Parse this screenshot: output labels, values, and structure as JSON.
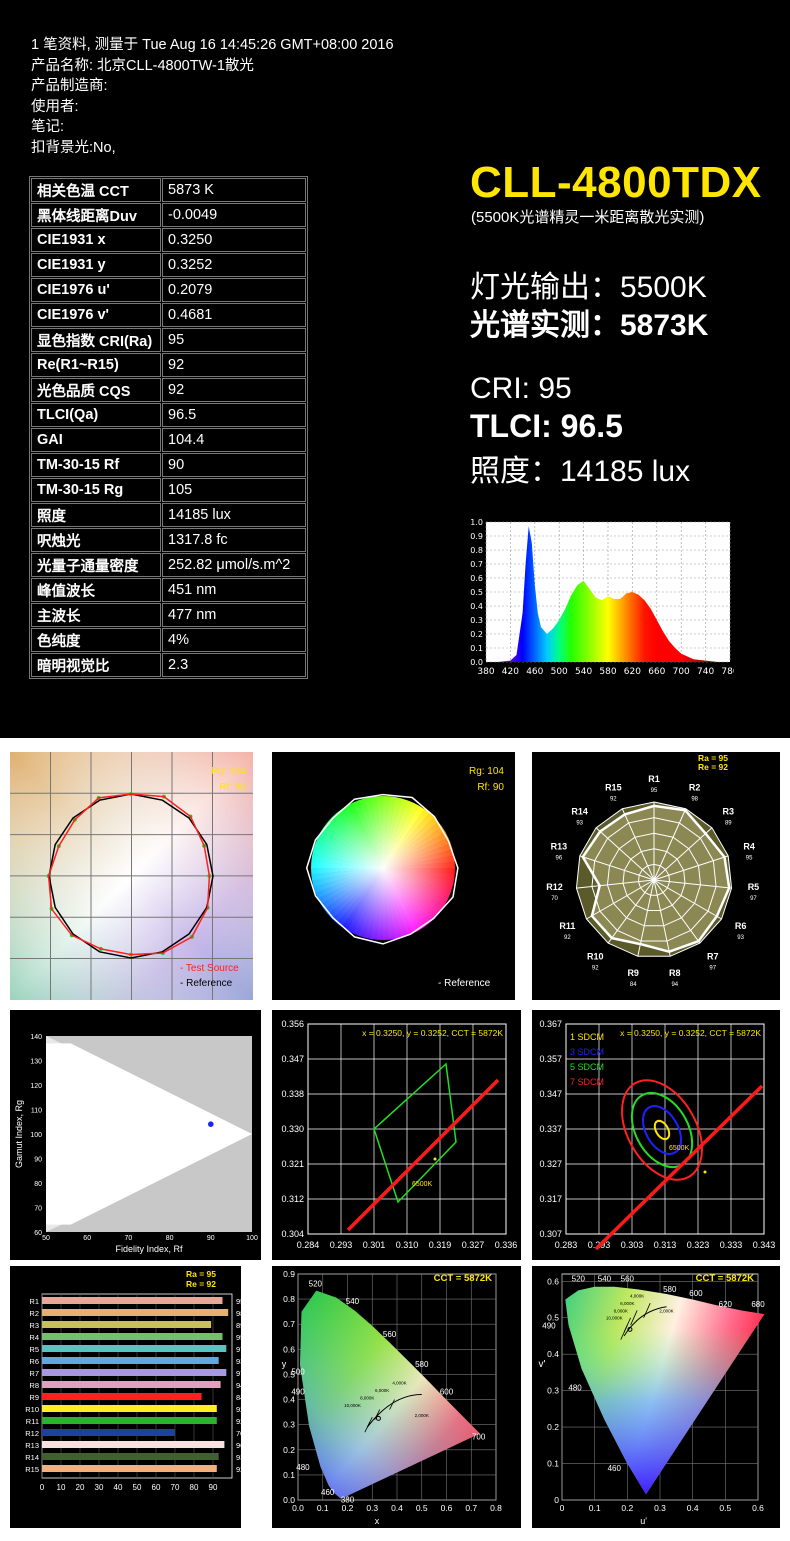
{
  "meta": {
    "line1": "1 笔资料, 测量于 Tue Aug 16 14:45:26 GMT+08:00 2016",
    "line2": "产品名称: 北京CLL-4800TW-1散光",
    "line3": "产品制造商:",
    "line4": "使用者:",
    "line5": "笔记:",
    "line6": "扣背景光:No,"
  },
  "spec_rows": [
    {
      "label": "相关色温 CCT",
      "value": "5873 K"
    },
    {
      "label": "黑体线距离Duv",
      "value": "-0.0049"
    },
    {
      "label": "CIE1931 x",
      "value": "0.3250"
    },
    {
      "label": "CIE1931 y",
      "value": "0.3252"
    },
    {
      "label": "CIE1976 u'",
      "value": "0.2079"
    },
    {
      "label": "CIE1976 v'",
      "value": "0.4681"
    },
    {
      "label": "显色指数 CRI(Ra)",
      "value": "95"
    },
    {
      "label": "Re(R1~R15)",
      "value": "92"
    },
    {
      "label": "光色品质 CQS",
      "value": "92"
    },
    {
      "label": "TLCI(Qa)",
      "value": "96.5"
    },
    {
      "label": "GAI",
      "value": "104.4"
    },
    {
      "label": "TM-30-15 Rf",
      "value": "90"
    },
    {
      "label": "TM-30-15 Rg",
      "value": "105"
    },
    {
      "label": "照度",
      "value": "14185 lux"
    },
    {
      "label": "呎烛光",
      "value": "1317.8 fc"
    },
    {
      "label": "光量子通量密度",
      "value": "252.82 μmol/s.m^2"
    },
    {
      "label": "峰值波长",
      "value": "451 nm"
    },
    {
      "label": "主波长",
      "value": "477 nm"
    },
    {
      "label": "色纯度",
      "value": "4%"
    },
    {
      "label": "暗明视觉比",
      "value": "2.3"
    }
  ],
  "headline": {
    "model": "CLL-4800TDX",
    "subtitle": "(5500K光谱精灵一米距离散光实测)",
    "output": "灯光输出：5500K",
    "measured": "光谱实测：5873K",
    "cri": "CRI: 95",
    "tlci": "TLCI: 96.5",
    "lux": "照度：14185 lux"
  },
  "colors": {
    "accent": "#ffe600",
    "red": "#ff1a1a",
    "green": "#22dd22",
    "blue": "#2020ff"
  },
  "chart_data": [
    {
      "type": "area",
      "x": [
        380,
        400,
        420,
        430,
        440,
        445,
        450,
        455,
        460,
        465,
        470,
        480,
        490,
        500,
        510,
        520,
        530,
        540,
        550,
        560,
        570,
        580,
        590,
        600,
        610,
        620,
        630,
        640,
        650,
        660,
        670,
        680,
        690,
        700,
        720,
        740,
        760,
        780
      ],
      "y": [
        0,
        0,
        0.01,
        0.05,
        0.35,
        0.7,
        0.97,
        0.85,
        0.55,
        0.35,
        0.25,
        0.2,
        0.24,
        0.3,
        0.38,
        0.48,
        0.55,
        0.58,
        0.52,
        0.46,
        0.44,
        0.47,
        0.45,
        0.45,
        0.49,
        0.5,
        0.48,
        0.44,
        0.38,
        0.3,
        0.22,
        0.15,
        0.1,
        0.06,
        0.02,
        0.01,
        0,
        0
      ],
      "ylim": [
        0,
        1.0
      ],
      "yticks": [
        "1.0",
        "0.9",
        "0.8",
        "0.7",
        "0.6",
        "0.5",
        "0.4",
        "0.3",
        "0.2",
        "0.1",
        "0.0"
      ],
      "xticks": [
        "380",
        "420",
        "460",
        "500",
        "540",
        "580",
        "620",
        "660",
        "700",
        "740",
        "780"
      ]
    },
    {
      "type": "line",
      "legend": [
        "- Test Source",
        "- Reference"
      ],
      "annotations": [
        "Rg: 104",
        "Rf: 90"
      ]
    },
    {
      "type": "pie",
      "legend": [
        "- Reference"
      ],
      "annotations": [
        "Rg: 104",
        "Rf: 90"
      ]
    },
    {
      "type": "line",
      "annotations": [
        "Ra = 95",
        "Re = 92"
      ],
      "categories": [
        "R1",
        "R2",
        "R3",
        "R4",
        "R5",
        "R6",
        "R7",
        "R8",
        "R9",
        "R10",
        "R11",
        "R12",
        "R13",
        "R14",
        "R15"
      ],
      "values": [
        95,
        98,
        89,
        95,
        97,
        93,
        97,
        94,
        84,
        92,
        92,
        70,
        96,
        93,
        92
      ]
    },
    {
      "type": "scatter",
      "xlabel": "Fidelity Index, Rf",
      "ylabel": "Gamut Index, Rg",
      "xticks": [
        "50",
        "60",
        "70",
        "80",
        "90",
        "100"
      ],
      "yticks": [
        "140",
        "130",
        "120",
        "110",
        "100",
        "90",
        "80",
        "70",
        "60"
      ],
      "points": [
        {
          "x": 90,
          "y": 104
        }
      ]
    },
    {
      "type": "line",
      "annotation": "x = 0.3250, y = 0.3252, CCT = 5872K",
      "cct_label": "6500K",
      "xticks": [
        "0.284",
        "0.293",
        "0.301",
        "0.310",
        "0.319",
        "0.327",
        "0.336"
      ],
      "yticks": [
        "0.356",
        "0.347",
        "0.338",
        "0.330",
        "0.321",
        "0.312",
        "0.304"
      ]
    },
    {
      "type": "line",
      "annotation": "x = 0.3250, y = 0.3252, CCT = 5872K",
      "legend": [
        "1 SDCM",
        "3 SDCM",
        "5 SDCM",
        "7 SDCM"
      ],
      "cct_label": "6500K",
      "xticks": [
        "0.283",
        "0.293",
        "0.303",
        "0.313",
        "0.323",
        "0.333",
        "0.343"
      ],
      "yticks": [
        "0.367",
        "0.357",
        "0.347",
        "0.337",
        "0.327",
        "0.317",
        "0.307"
      ]
    },
    {
      "type": "bar",
      "annotations": [
        "Ra = 95",
        "Re = 92"
      ],
      "categories": [
        "R1",
        "R2",
        "R3",
        "R4",
        "R5",
        "R6",
        "R7",
        "R8",
        "R9",
        "R10",
        "R11",
        "R12",
        "R13",
        "R14",
        "R15"
      ],
      "values": [
        95,
        98,
        89,
        95,
        97,
        93,
        97,
        94,
        84,
        92,
        92,
        70,
        96,
        93,
        92
      ],
      "bar_colors": [
        "#e8a898",
        "#e8b070",
        "#c8c060",
        "#70c070",
        "#60c0c0",
        "#60a8e0",
        "#a898e0",
        "#e0a0c0",
        "#ff2020",
        "#ffee20",
        "#30b030",
        "#2040a0",
        "#f8e0e0",
        "#406030",
        "#f0b080"
      ],
      "xticks": [
        "0",
        "10",
        "20",
        "30",
        "40",
        "50",
        "60",
        "70",
        "80",
        "90"
      ],
      "xlim": [
        0,
        100
      ]
    },
    {
      "type": "scatter",
      "annotation": "CCT = 5872K",
      "xlabel": "x",
      "ylabel": "y",
      "xticks": [
        "0.0",
        "0.1",
        "0.2",
        "0.3",
        "0.4",
        "0.5",
        "0.6",
        "0.7",
        "0.8"
      ],
      "yticks": [
        "0.9",
        "0.8",
        "0.7",
        "0.6",
        "0.5",
        "0.4",
        "0.3",
        "0.2",
        "0.1",
        "0.0"
      ],
      "wavelengths": [
        "520",
        "540",
        "560",
        "580",
        "600",
        "700",
        "500",
        "490",
        "480",
        "460",
        "380"
      ],
      "cct_labels": [
        "4,000K",
        "6,000K",
        "8,000K",
        "10,000K",
        "2,000K"
      ]
    },
    {
      "type": "scatter",
      "annotation": "CCT = 5872K",
      "xlabel": "u'",
      "ylabel": "v'",
      "xticks": [
        "0",
        "0.1",
        "0.2",
        "0.3",
        "0.4",
        "0.5",
        "0.6"
      ],
      "yticks": [
        "0.6",
        "0.5",
        "0.4",
        "0.3",
        "0.2",
        "0.1",
        "0"
      ],
      "wavelengths": [
        "520",
        "540",
        "560",
        "580",
        "600",
        "620",
        "680",
        "490",
        "480",
        "460"
      ],
      "cct_labels": [
        "4,000K",
        "6,000K",
        "8,000K",
        "10,000K",
        "2,000K"
      ]
    }
  ]
}
